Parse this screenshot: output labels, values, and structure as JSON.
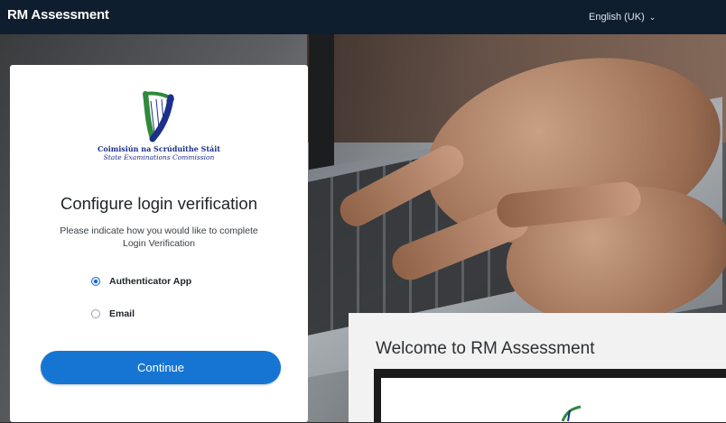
{
  "header": {
    "app_title": "RM Assessment",
    "language": "English (UK)",
    "language_icon": "chevron-down-icon"
  },
  "login_card": {
    "org_name_ga": "Coimisiún na Scrúduithe Stáit",
    "org_name_en": "State Examinations Commission",
    "title": "Configure login verification",
    "description": "Please indicate how you would like to complete Login Verification",
    "options": [
      {
        "label": "Authenticator App",
        "selected": true
      },
      {
        "label": "Email",
        "selected": false
      }
    ],
    "continue_label": "Continue"
  },
  "background": {
    "welcome_title": "Welcome to RM Assessment"
  },
  "colors": {
    "topbar": "#0f1e2e",
    "accent": "#1675d2",
    "logo_blue": "#1c2f8a",
    "logo_green": "#2f8a3c"
  }
}
